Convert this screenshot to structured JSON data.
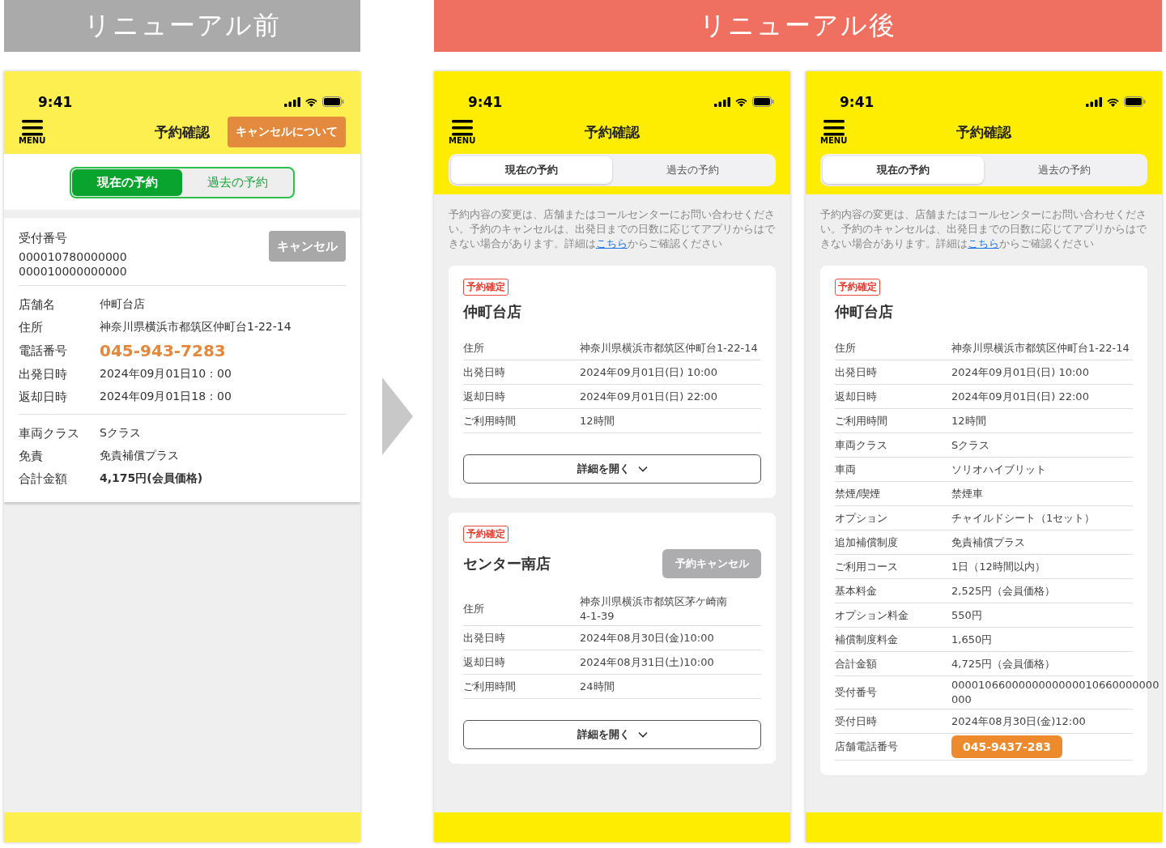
{
  "before": {
    "banner": "リニューアル前",
    "phone": {
      "time": "9:41",
      "menu_label": "MENU",
      "title": "予約確認",
      "header_button": "キャンセルについて",
      "tabs": [
        {
          "label": "現在の予約",
          "selected": true
        },
        {
          "label": "過去の予約",
          "selected": false
        }
      ],
      "receipt": {
        "label": "受付番号",
        "numbers": [
          "000010780000000",
          "000010000000000"
        ],
        "cancel_button": "キャンセル"
      },
      "groups": [
        [
          {
            "label": "店舗名",
            "value": "仲町台店",
            "kind": "plain"
          },
          {
            "label": "住所",
            "value": "神奈川県横浜市都筑区仲町台1-22-14",
            "kind": "plain"
          },
          {
            "label": "電話番号",
            "value": "045-943-7283",
            "kind": "phone"
          },
          {
            "label": "出発日時",
            "value": "2024年09月01日10：00",
            "kind": "plain"
          },
          {
            "label": "返却日時",
            "value": "2024年09月01日18：00",
            "kind": "plain"
          }
        ],
        [
          {
            "label": "車両クラス",
            "value": "Sクラス",
            "kind": "plain"
          },
          {
            "label": "免責",
            "value": "免責補償プラス",
            "kind": "plain"
          },
          {
            "label": "合計金額",
            "value": "4,175円(会員価格)",
            "kind": "bold"
          }
        ]
      ]
    }
  },
  "after": {
    "banner": "リニューアル後",
    "phones": [
      {
        "time": "9:41",
        "menu_label": "MENU",
        "title": "予約確認",
        "tabs": [
          {
            "label": "現在の予約",
            "selected": true
          },
          {
            "label": "過去の予約",
            "selected": false
          }
        ],
        "notice": {
          "text": "予約内容の変更は、店舗またはコールセンターにお問い合わせください。予約のキャンセルは、出発日までの日数に応じてアプリからはできない場合があります。詳細は",
          "link": "こちら",
          "tail": "からご確認ください"
        },
        "cards": [
          {
            "status": "予約確定",
            "store": "仲町台店",
            "expand_button": "詳細を開く",
            "rows": [
              {
                "label": "住所",
                "value": "神奈川県横浜市都筑区仲町台1-22-14",
                "kind": "plain"
              },
              {
                "label": "出発日時",
                "value": "2024年09月01日(日) 10:00",
                "kind": "plain"
              },
              {
                "label": "返却日時",
                "value": "2024年09月01日(日) 22:00",
                "kind": "plain"
              },
              {
                "label": "ご利用時間",
                "value": "12時間",
                "kind": "plain"
              }
            ]
          },
          {
            "status": "予約確定",
            "store": "センター南店",
            "cancel_button": "予約キャンセル",
            "expand_button": "詳細を開く",
            "rows": [
              {
                "label": "住所",
                "value": "神奈川県横浜市都筑区茅ケ崎南\n4-1-39",
                "kind": "plain"
              },
              {
                "label": "出発日時",
                "value": "2024年08月30日(金)10:00",
                "kind": "plain"
              },
              {
                "label": "返却日時",
                "value": "2024年08月31日(土)10:00",
                "kind": "plain"
              },
              {
                "label": "ご利用時間",
                "value": "24時間",
                "kind": "plain"
              }
            ]
          }
        ]
      },
      {
        "time": "9:41",
        "menu_label": "MENU",
        "title": "予約確認",
        "tabs": [
          {
            "label": "現在の予約",
            "selected": true
          },
          {
            "label": "過去の予約",
            "selected": false
          }
        ],
        "notice": {
          "text": "予約内容の変更は、店舗またはコールセンターにお問い合わせください。予約のキャンセルは、出発日までの日数に応じてアプリからはできない場合があります。詳細は",
          "link": "こちら",
          "tail": "からご確認ください"
        },
        "cards": [
          {
            "status": "予約確定",
            "store": "仲町台店",
            "rows": [
              {
                "label": "住所",
                "value": "神奈川県横浜市都筑区仲町台1-22-14",
                "kind": "plain"
              },
              {
                "label": "出発日時",
                "value": "2024年09月01日(日) 10:00",
                "kind": "plain"
              },
              {
                "label": "返却日時",
                "value": "2024年09月01日(日) 22:00",
                "kind": "plain"
              },
              {
                "label": "ご利用時間",
                "value": "12時間",
                "kind": "plain"
              },
              {
                "label": "車両クラス",
                "value": "Sクラス",
                "kind": "plain"
              },
              {
                "label": "車両",
                "value": "ソリオハイブリット",
                "kind": "plain"
              },
              {
                "label": "禁煙/喫煙",
                "value": "禁煙車",
                "kind": "plain"
              },
              {
                "label": "オプション",
                "value": "チャイルドシート（1セット）",
                "kind": "plain"
              },
              {
                "label": "追加補償制度",
                "value": "免責補償プラス",
                "kind": "plain"
              },
              {
                "label": "ご利用コース",
                "value": "1日（12時間以内）",
                "kind": "plain"
              },
              {
                "label": "基本料金",
                "value": "2,525円（会員価格）",
                "kind": "plain"
              },
              {
                "label": "オプション料金",
                "value": "550円",
                "kind": "plain"
              },
              {
                "label": "補償制度料金",
                "value": "1,650円",
                "kind": "plain"
              },
              {
                "label": "合計金額",
                "value": "4,725円（会員価格）",
                "kind": "plain"
              },
              {
                "label": "受付番号",
                "value": "0000106600000000000010660000000\n000",
                "kind": "plain"
              },
              {
                "label": "受付日時",
                "value": "2024年08月30日(金)12:00",
                "kind": "plain"
              },
              {
                "label": "店舗電話番号",
                "value": "045-9437-283",
                "kind": "phone_button"
              }
            ]
          }
        ]
      }
    ]
  }
}
